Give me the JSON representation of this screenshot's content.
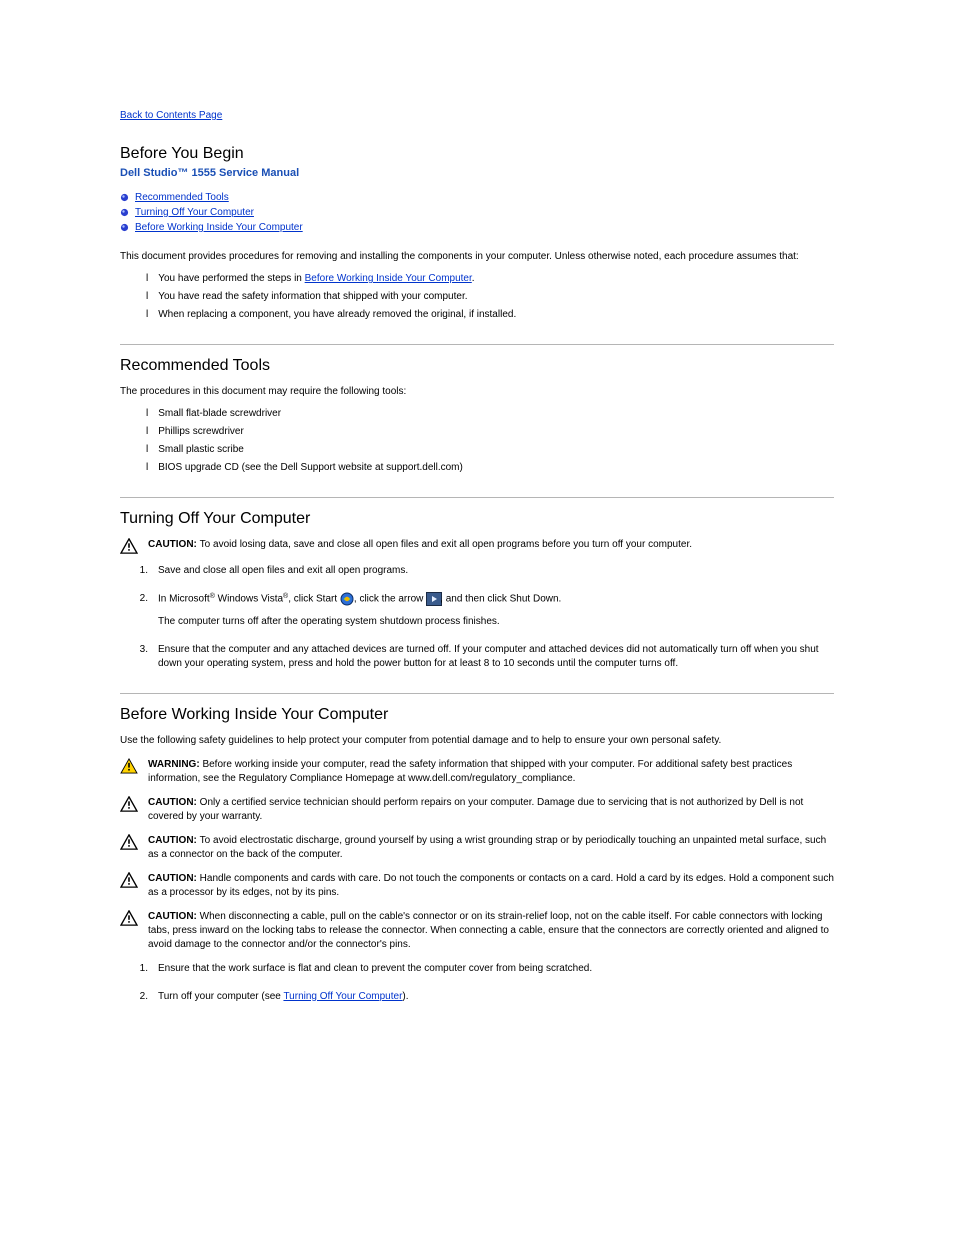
{
  "nav": {
    "back_to_contents": "Back to Contents Page"
  },
  "header": {
    "title": "Before You Begin",
    "subtitle": "Dell Studio™ 1555 Service Manual"
  },
  "toc": {
    "items": [
      {
        "label": "Recommended Tools"
      },
      {
        "label": "Turning Off Your Computer"
      },
      {
        "label": "Before Working Inside Your Computer"
      }
    ]
  },
  "intro": {
    "p1_a": "This document provides procedures for removing and installing the components in your computer. Unless otherwise noted, each procedure assumes that:",
    "p1_li1": "You have performed the steps in ",
    "p1_li1_link": "Before Working Inside Your Computer",
    "p1_li1_tail": ".",
    "p1_li2": "You have read the safety information that shipped with your computer.",
    "p1_li3": "When replacing a component, you have already removed the original, if installed."
  },
  "tools": {
    "title": "Recommended Tools",
    "intro": "The procedures in this document may require the following tools:",
    "items": [
      "Small flat-blade screwdriver",
      "Phillips screwdriver",
      "Small plastic scribe",
      "BIOS upgrade CD (see the Dell Support website at support.dell.com)"
    ]
  },
  "shutdown": {
    "title": "Turning Off Your Computer",
    "caution_label": "CAUTION: ",
    "caution": "To avoid losing data, save and close all open files and exit all open programs before you turn off your computer.",
    "steps": {
      "s1": "Save and close all open files and exit all open programs.",
      "s2a_prefix": "In Microsoft",
      "s2a_windows": " Windows Vista",
      "s2a_mid": ", click Start",
      "s2a_arrow": ", click the arrow",
      "s2a_tail": ", and then click Shut Down.",
      "s2b": "The computer turns off after the operating system shutdown process finishes.",
      "s3": "Ensure that the computer and any attached devices are turned off. If your computer and attached devices did not automatically turn off when you shut down your operating system, press and hold the power button for at least 8 to 10 seconds until the computer turns off."
    }
  },
  "before_inside": {
    "title": "Before Working Inside Your Computer",
    "intro": "Use the following safety guidelines to help protect your computer from potential damage and to help to ensure your own personal safety.",
    "warn_label": "WARNING: ",
    "warn": "Before working inside your computer, read the safety information that shipped with your computer. For additional safety best practices information, see the Regulatory Compliance Homepage at www.dell.com/regulatory_compliance.",
    "c1_label": "CAUTION: ",
    "c1": "Only a certified service technician should perform repairs on your computer. Damage due to servicing that is not authorized by Dell is not covered by your warranty.",
    "c2_label": "CAUTION: ",
    "c2": "To avoid electrostatic discharge, ground yourself by using a wrist grounding strap or by periodically touching an unpainted metal surface, such as a connector on the back of the computer.",
    "c3_label": "CAUTION: ",
    "c3": "Handle components and cards with care. Do not touch the components or contacts on a card. Hold a card by its edges. Hold a component such as a processor by its edges, not by its pins.",
    "c4_label": "CAUTION: ",
    "c4": "When disconnecting a cable, pull on the cable's connector or on its strain-relief loop, not on the cable itself. For cable connectors with locking tabs, press inward on the locking tabs to release the connector. When connecting a cable, ensure that the connectors are correctly oriented and aligned to avoid damage to the connector and/or the connector's pins.",
    "steps": {
      "s1": "Ensure that the work surface is flat and clean to prevent the computer cover from being scratched.",
      "s2a": "Turn off your computer (see ",
      "s2a_link": "Turning Off Your Computer",
      "s2a_tail": ")."
    }
  }
}
